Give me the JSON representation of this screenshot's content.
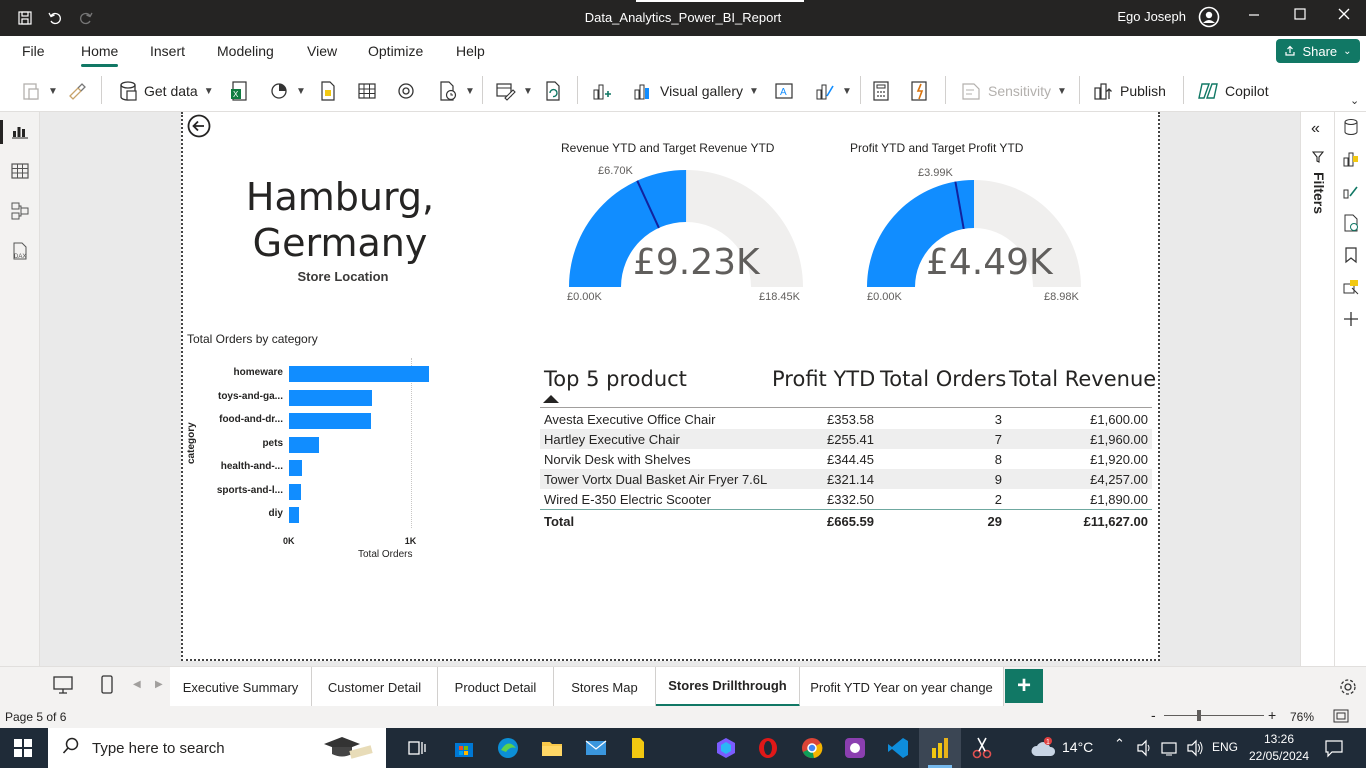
{
  "window": {
    "title": "Data_Analytics_Power_BI_Report",
    "user": "Ego Joseph"
  },
  "menu": {
    "items": [
      "File",
      "Home",
      "Insert",
      "Modeling",
      "View",
      "Optimize",
      "Help"
    ],
    "active": "Home",
    "share_label": "Share"
  },
  "ribbon": {
    "get_data": "Get data",
    "visual_gallery": "Visual gallery",
    "sensitivity": "Sensitivity",
    "publish": "Publish",
    "copilot": "Copilot"
  },
  "filters_label": "Filters",
  "store": {
    "title_line1": "Hamburg,",
    "title_line2": "Germany",
    "subtitle": "Store Location"
  },
  "gauges": [
    {
      "title": "Revenue YTD and Target Revenue YTD",
      "value_label": "£9.23K",
      "value": 9.23,
      "min_label": "£0.00K",
      "min": 0,
      "max_label": "£18.45K",
      "max": 18.45,
      "target_label": "£6.70K",
      "target": 6.7,
      "fill_color": "#118dff",
      "track_color": "#f0efee"
    },
    {
      "title": "Profit YTD and Target Profit YTD",
      "value_label": "£4.49K",
      "value": 4.49,
      "min_label": "£0.00K",
      "min": 0,
      "max_label": "£8.98K",
      "max": 8.98,
      "target_label": "£3.99K",
      "target": 3.99,
      "fill_color": "#118dff",
      "track_color": "#f0efee"
    }
  ],
  "chart_data": {
    "type": "bar",
    "title": "Total Orders by category",
    "xlabel": "Total Orders",
    "ylabel": "category",
    "categories": [
      "homeware",
      "toys-and-ga...",
      "food-and-dr...",
      "pets",
      "health-and-...",
      "sports-and-l...",
      "diy"
    ],
    "values": [
      1150,
      680,
      670,
      250,
      110,
      100,
      85
    ],
    "xlim": [
      0,
      1150
    ],
    "xticks": [
      "0K",
      "1K"
    ],
    "color": "#118dff"
  },
  "table": {
    "headers": [
      "Top 5 product",
      "Profit YTD",
      "Total Orders",
      "Total Revenue"
    ],
    "rows": [
      [
        "Avesta Executive Office Chair",
        "£353.58",
        "3",
        "£1,600.00"
      ],
      [
        "Hartley Executive Chair",
        "£255.41",
        "7",
        "£1,960.00"
      ],
      [
        "Norvik Desk with Shelves",
        "£344.45",
        "8",
        "£1,920.00"
      ],
      [
        "Tower Vortx Dual Basket Air Fryer 7.6L",
        "£321.14",
        "9",
        "£4,257.00"
      ],
      [
        "Wired E-350 Electric Scooter",
        "£332.50",
        "2",
        "£1,890.00"
      ]
    ],
    "total": [
      "Total",
      "£665.59",
      "29",
      "£11,627.00"
    ]
  },
  "tabs": [
    "Executive Summary",
    "Customer Detail",
    "Product Detail",
    "Stores Map",
    "Stores Drillthrough",
    "Profit YTD Year on year change"
  ],
  "active_tab": "Stores Drillthrough",
  "status": {
    "page": "Page 5 of 6",
    "zoom": "76%"
  },
  "taskbar": {
    "search_placeholder": "Type here to search",
    "temperature": "14°C",
    "language": "ENG",
    "time": "13:26",
    "date": "22/05/2024"
  }
}
